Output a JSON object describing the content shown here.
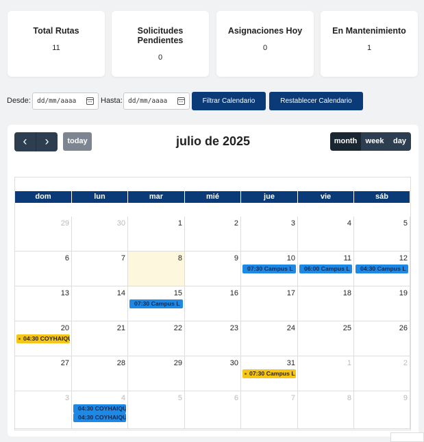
{
  "stats": [
    {
      "title": "Total Rutas",
      "value": "11"
    },
    {
      "title": "Solicitudes Pendientes",
      "value": "0"
    },
    {
      "title": "Asignaciones Hoy",
      "value": "0"
    },
    {
      "title": "En Mantenimiento",
      "value": "1"
    }
  ],
  "filters": {
    "desde_label": "Desde:",
    "hasta_label": "Hasta:",
    "desde_placeholder": "dd/mm/aaaa",
    "hasta_placeholder": "dd/mm/aaaa",
    "filter_button": "Filtrar Calendario",
    "reset_button": "Restablecer Calendario"
  },
  "calendar": {
    "prev_icon": "‹",
    "next_icon": "›",
    "today_label": "today",
    "title": "julio de 2025",
    "views": [
      "month",
      "week",
      "day"
    ],
    "active_view": "month",
    "weekdays": [
      "dom",
      "lun",
      "mar",
      "mié",
      "jue",
      "vie",
      "sáb"
    ],
    "weeks": [
      [
        {
          "n": "29",
          "other": true
        },
        {
          "n": "30",
          "other": true
        },
        {
          "n": "1"
        },
        {
          "n": "2"
        },
        {
          "n": "3"
        },
        {
          "n": "4"
        },
        {
          "n": "5"
        }
      ],
      [
        {
          "n": "6"
        },
        {
          "n": "7"
        },
        {
          "n": "8",
          "today": true
        },
        {
          "n": "9"
        },
        {
          "n": "10",
          "events": [
            {
              "text": "07:30 Campus L",
              "color": "blue"
            }
          ]
        },
        {
          "n": "11",
          "events": [
            {
              "text": "06:00 Campus L",
              "color": "blue"
            }
          ]
        },
        {
          "n": "12",
          "events": [
            {
              "text": "04:30 Campus L",
              "color": "blue"
            }
          ]
        }
      ],
      [
        {
          "n": "13"
        },
        {
          "n": "14"
        },
        {
          "n": "15",
          "events": [
            {
              "text": "07:30 Campus L",
              "color": "blue"
            }
          ]
        },
        {
          "n": "16"
        },
        {
          "n": "17"
        },
        {
          "n": "18"
        },
        {
          "n": "19"
        }
      ],
      [
        {
          "n": "20",
          "events": [
            {
              "text": "04:30 COYHAIQU",
              "color": "yellow"
            }
          ]
        },
        {
          "n": "21"
        },
        {
          "n": "22"
        },
        {
          "n": "23"
        },
        {
          "n": "24"
        },
        {
          "n": "25"
        },
        {
          "n": "26"
        }
      ],
      [
        {
          "n": "27"
        },
        {
          "n": "28"
        },
        {
          "n": "29"
        },
        {
          "n": "30"
        },
        {
          "n": "31",
          "events": [
            {
              "text": "07:30 Campus L",
              "color": "yellow"
            }
          ]
        },
        {
          "n": "1",
          "other": true
        },
        {
          "n": "2",
          "other": true
        }
      ],
      [
        {
          "n": "3",
          "other": true
        },
        {
          "n": "4",
          "other": true,
          "events": [
            {
              "text": "04:30 COYHAIQU",
              "color": "blue"
            },
            {
              "text": "04:30 COYHAIQU",
              "color": "blue"
            }
          ]
        },
        {
          "n": "5",
          "other": true
        },
        {
          "n": "6",
          "other": true
        },
        {
          "n": "7",
          "other": true
        },
        {
          "n": "8",
          "other": true
        },
        {
          "n": "9",
          "other": true
        }
      ]
    ]
  },
  "corner_text": "",
  "colors": {
    "primary": "#0b3a78",
    "nav": "#2c3e50",
    "event_blue": "#1e88e5",
    "event_yellow": "#f5c518",
    "today_bg": "#fdf7de"
  }
}
